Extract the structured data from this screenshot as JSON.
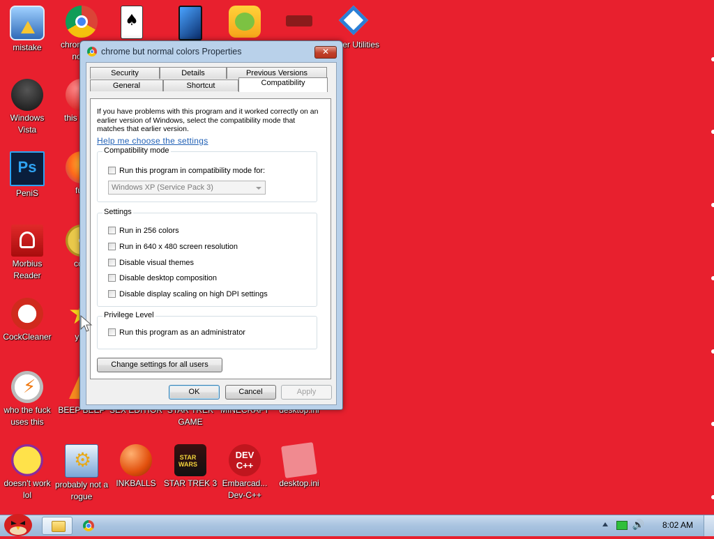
{
  "desktop_icons": [
    {
      "label": "mistake",
      "icon": "computer-warning-icon"
    },
    {
      "label": "chrome but norm",
      "icon": "chrome-icon"
    },
    {
      "label": "",
      "icon": "solitaire-cards-icon"
    },
    {
      "label": "",
      "icon": "blue-phone-icon"
    },
    {
      "label": "",
      "icon": "bad-piggies-icon"
    },
    {
      "label": "",
      "icon": "shield-logo-icon"
    },
    {
      "label": "Super Utilities",
      "icon": "utilities-icon"
    },
    {
      "label": "Windows Vista",
      "icon": "vista-icon"
    },
    {
      "label": "this like a",
      "icon": "red-ball-icon"
    },
    {
      "label": "PeniS",
      "icon": "photoshop-icon"
    },
    {
      "label": "furr",
      "icon": "firefox-icon"
    },
    {
      "label": "Morbius Reader",
      "icon": "acrobat-icon"
    },
    {
      "label": "cd c",
      "icon": "cd-icon"
    },
    {
      "label": "CockCleaner",
      "icon": "ccleaner-icon"
    },
    {
      "label": "you",
      "icon": "star-icon"
    },
    {
      "label": "who the fuck uses this",
      "icon": "winamp-icon"
    },
    {
      "label": "BEEP BEEP",
      "icon": "vlc-icon"
    },
    {
      "label": "SEX EDITIOR",
      "icon": "editor-icon"
    },
    {
      "label": "STAR TREK GAME",
      "icon": "star-trek-icon"
    },
    {
      "label": "MINECRAFT",
      "icon": "minecraft-icon"
    },
    {
      "label": "desktop.ini",
      "icon": "ini-file-icon"
    },
    {
      "label": "doesn't work lol",
      "icon": "yahoo-messenger-icon"
    },
    {
      "label": "probably not a rogue",
      "icon": "settings-gears-icon"
    },
    {
      "label": "INKBALLS",
      "icon": "inkball-icon"
    },
    {
      "label": "STAR TREK 3",
      "icon": "star-wars-icon"
    },
    {
      "label": "Embarcad... Dev-C++",
      "icon": "devcpp-icon"
    },
    {
      "label": "desktop.ini",
      "icon": "ini-file-icon"
    }
  ],
  "dialog": {
    "title": "chrome but normal colors Properties",
    "close_glyph": "✕",
    "tabs_row1": [
      "Security",
      "Details",
      "Previous Versions"
    ],
    "tabs_row2": [
      "General",
      "Shortcut",
      "Compatibility"
    ],
    "active_tab": "Compatibility",
    "intro": "If you have problems with this program and it worked correctly on an earlier version of Windows, select the compatibility mode that matches that earlier version.",
    "help_link": "Help me choose the settings",
    "compat_group": "Compatibility mode",
    "compat_checkbox": "Run this program in compatibility mode for:",
    "compat_select_value": "Windows XP (Service Pack 3)",
    "settings_group": "Settings",
    "settings": [
      "Run in 256 colors",
      "Run in 640 x 480 screen resolution",
      "Disable visual themes",
      "Disable desktop composition",
      "Disable display scaling on high DPI settings"
    ],
    "privilege_group": "Privilege Level",
    "privilege_checkbox": "Run this program as an administrator",
    "change_all_button": "Change settings for all users",
    "ok_button": "OK",
    "cancel_button": "Cancel",
    "apply_button": "Apply"
  },
  "taskbar": {
    "clock": "8:02 AM",
    "items": [
      "angry-birds-start-icon",
      "explorer-folder-icon",
      "chrome-icon"
    ],
    "tray": [
      "show-hidden-icons-icon",
      "network-icon",
      "volume-icon"
    ]
  }
}
